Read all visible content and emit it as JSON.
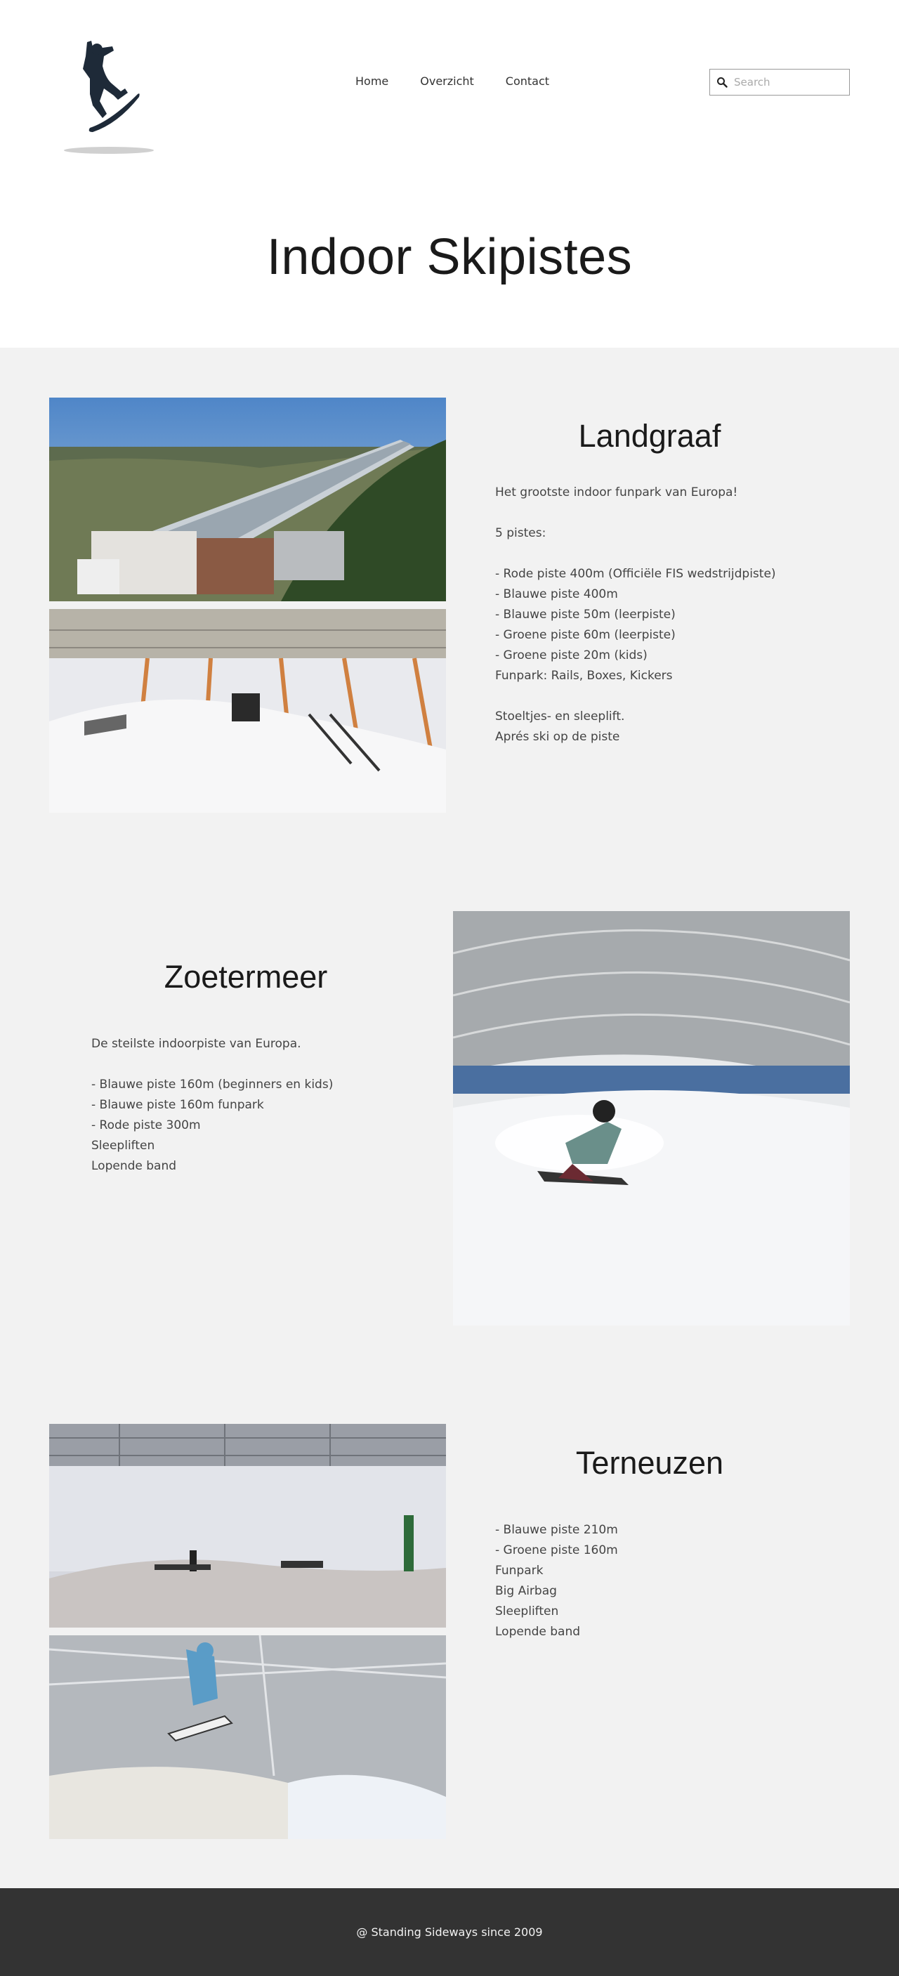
{
  "header": {
    "nav": [
      {
        "label": "Home"
      },
      {
        "label": "Overzicht"
      },
      {
        "label": "Contact"
      }
    ],
    "search": {
      "placeholder": "Search"
    }
  },
  "page": {
    "title": "Indoor Skipistes"
  },
  "sections": [
    {
      "title": "Landgraaf",
      "lines": [
        "Het grootste indoor funpark van Europa!",
        "",
        "5 pistes:",
        "",
        "- Rode piste 400m (Officiële FIS wedstrijdpiste)",
        "- Blauwe piste 400m",
        "- Blauwe piste 50m (leerpiste)",
        "- Groene piste 60m (leerpiste)",
        "- Groene piste 20m (kids)",
        "Funpark: Rails, Boxes, Kickers",
        "",
        "Stoeltjes- en sleeplift.",
        "Aprés ski op de piste"
      ]
    },
    {
      "title": "Zoetermeer",
      "lines": [
        "De steilste indoorpiste van Europa.",
        "",
        "- Blauwe piste 160m (beginners en kids)",
        "- Blauwe piste 160m funpark",
        "- Rode piste 300m",
        "Sleepliften",
        "Lopende band"
      ]
    },
    {
      "title": "Terneuzen",
      "lines": [
        "- Blauwe piste 210m",
        "- Groene piste 160m",
        "Funpark",
        "Big Airbag",
        "Sleepliften",
        "Lopende band"
      ]
    }
  ],
  "footer": {
    "copyright": "@ Standing Sideways since 2009"
  }
}
